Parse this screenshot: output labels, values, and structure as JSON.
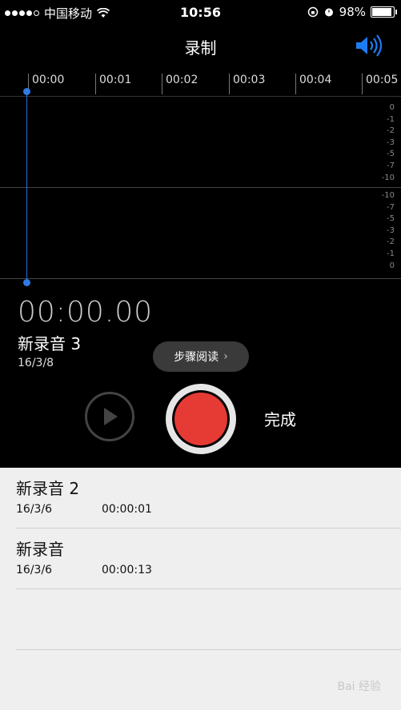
{
  "status": {
    "carrier": "中国移动",
    "time": "10:56",
    "battery": "98%"
  },
  "nav": {
    "title": "录制"
  },
  "timeline": {
    "labels": [
      "00:00",
      "00:01",
      "00:02",
      "00:03",
      "00:04",
      "00:05"
    ]
  },
  "scale_top": [
    "0",
    "-1",
    "-2",
    "-3",
    "-5",
    "-7",
    "-10"
  ],
  "scale_bottom": [
    "-10",
    "-7",
    "-5",
    "-3",
    "-2",
    "-1",
    "0"
  ],
  "recording": {
    "counter": "00:00.00",
    "name": "新录音 3",
    "date": "16/3/8"
  },
  "overlay": {
    "steps_label": "步骤阅读",
    "steps_chevron": "›"
  },
  "controls": {
    "done_label": "完成"
  },
  "list": [
    {
      "name": "新录音 2",
      "date": "16/3/6",
      "duration": "00:00:01"
    },
    {
      "name": "新录音",
      "date": "16/3/6",
      "duration": "00:00:13"
    }
  ],
  "watermark": "Bai 经验"
}
